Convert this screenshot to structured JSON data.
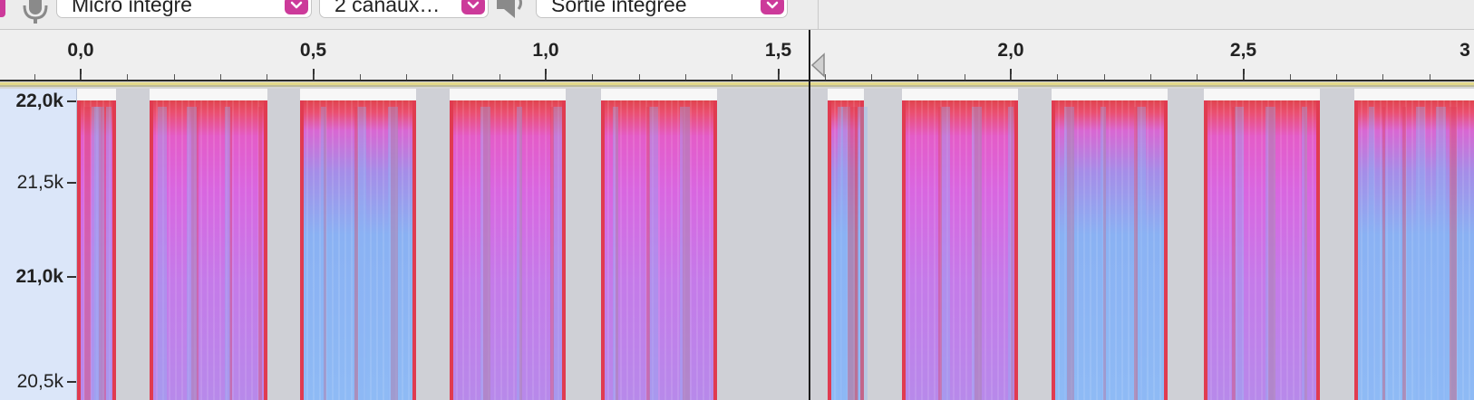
{
  "toolbar": {
    "input_device": "Micro intégré",
    "channels": "2 canaux…",
    "output_device": "Sortie intégrée",
    "icons": [
      "microphone-icon",
      "speaker-icon",
      "chevron-down-icon"
    ]
  },
  "ruler": {
    "ticks": [
      {
        "label": "0,0",
        "value": 0.0
      },
      {
        "label": "0,5",
        "value": 0.5
      },
      {
        "label": "1,0",
        "value": 1.0
      },
      {
        "label": "1,5",
        "value": 1.5
      },
      {
        "label": "2,0",
        "value": 2.0
      },
      {
        "label": "2,5",
        "value": 2.5
      },
      {
        "label": "3",
        "value": 3.0
      }
    ],
    "playhead_time": 1.55
  },
  "vertical_scale": {
    "labels": [
      {
        "text": "22,0k",
        "bold": true
      },
      {
        "text": "21,5k",
        "bold": false
      },
      {
        "text": "21,0k",
        "bold": true
      },
      {
        "text": "20,5k",
        "bold": false
      }
    ]
  },
  "colors": {
    "accent": "#cc3a9a",
    "scale_bg": "#dbe6f9",
    "spectro_red": "#e0444e",
    "spectro_magenta": "#d966e0",
    "spectro_blue": "#8ebaf5"
  }
}
